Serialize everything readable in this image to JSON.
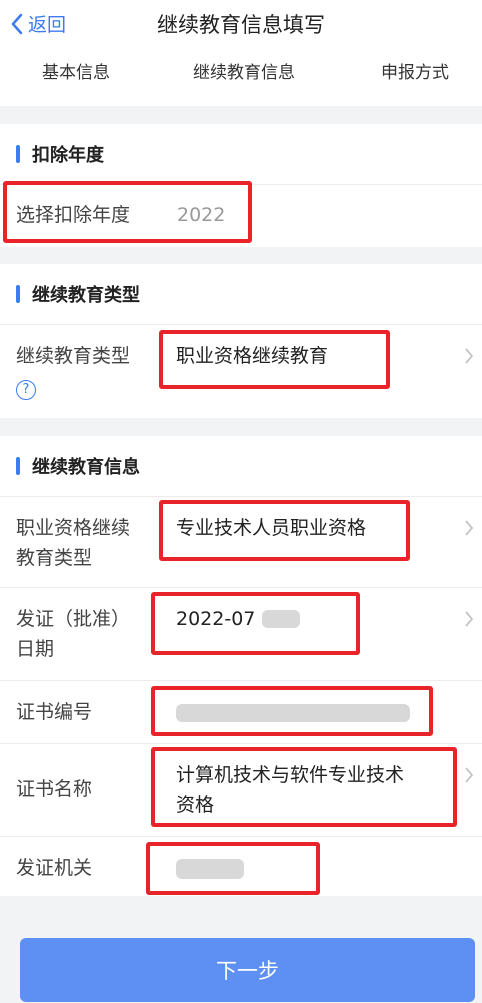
{
  "header": {
    "back_label": "返回",
    "title": "继续教育信息填写"
  },
  "tabs": [
    "基本信息",
    "继续教育信息",
    "申报方式"
  ],
  "sections": {
    "deduction_year": {
      "title": "扣除年度",
      "label": "选择扣除年度",
      "value": "2022"
    },
    "edu_type": {
      "title": "继续教育类型",
      "label": "继续教育类型",
      "value": "职业资格继续教育"
    },
    "edu_info": {
      "title": "继续教育信息",
      "rows": {
        "qual_type": {
          "label_l1": "职业资格继续",
          "label_l2": "教育类型",
          "value": "专业技术人员职业资格"
        },
        "issue_date": {
          "label_l1": "发证（批准）",
          "label_l2": "日期",
          "value": "2022-07"
        },
        "cert_no": {
          "label": "证书编号",
          "value": ""
        },
        "cert_name": {
          "label": "证书名称",
          "value_l1": "计算机技术与软件专业技术",
          "value_l2": "资格"
        },
        "issuer": {
          "label": "发证机关",
          "value": ""
        }
      }
    }
  },
  "footer": {
    "next_label": "下一步"
  },
  "colors": {
    "accent": "#3b7cf0",
    "highlight": "#e8232a",
    "button": "#5e8ff3"
  }
}
